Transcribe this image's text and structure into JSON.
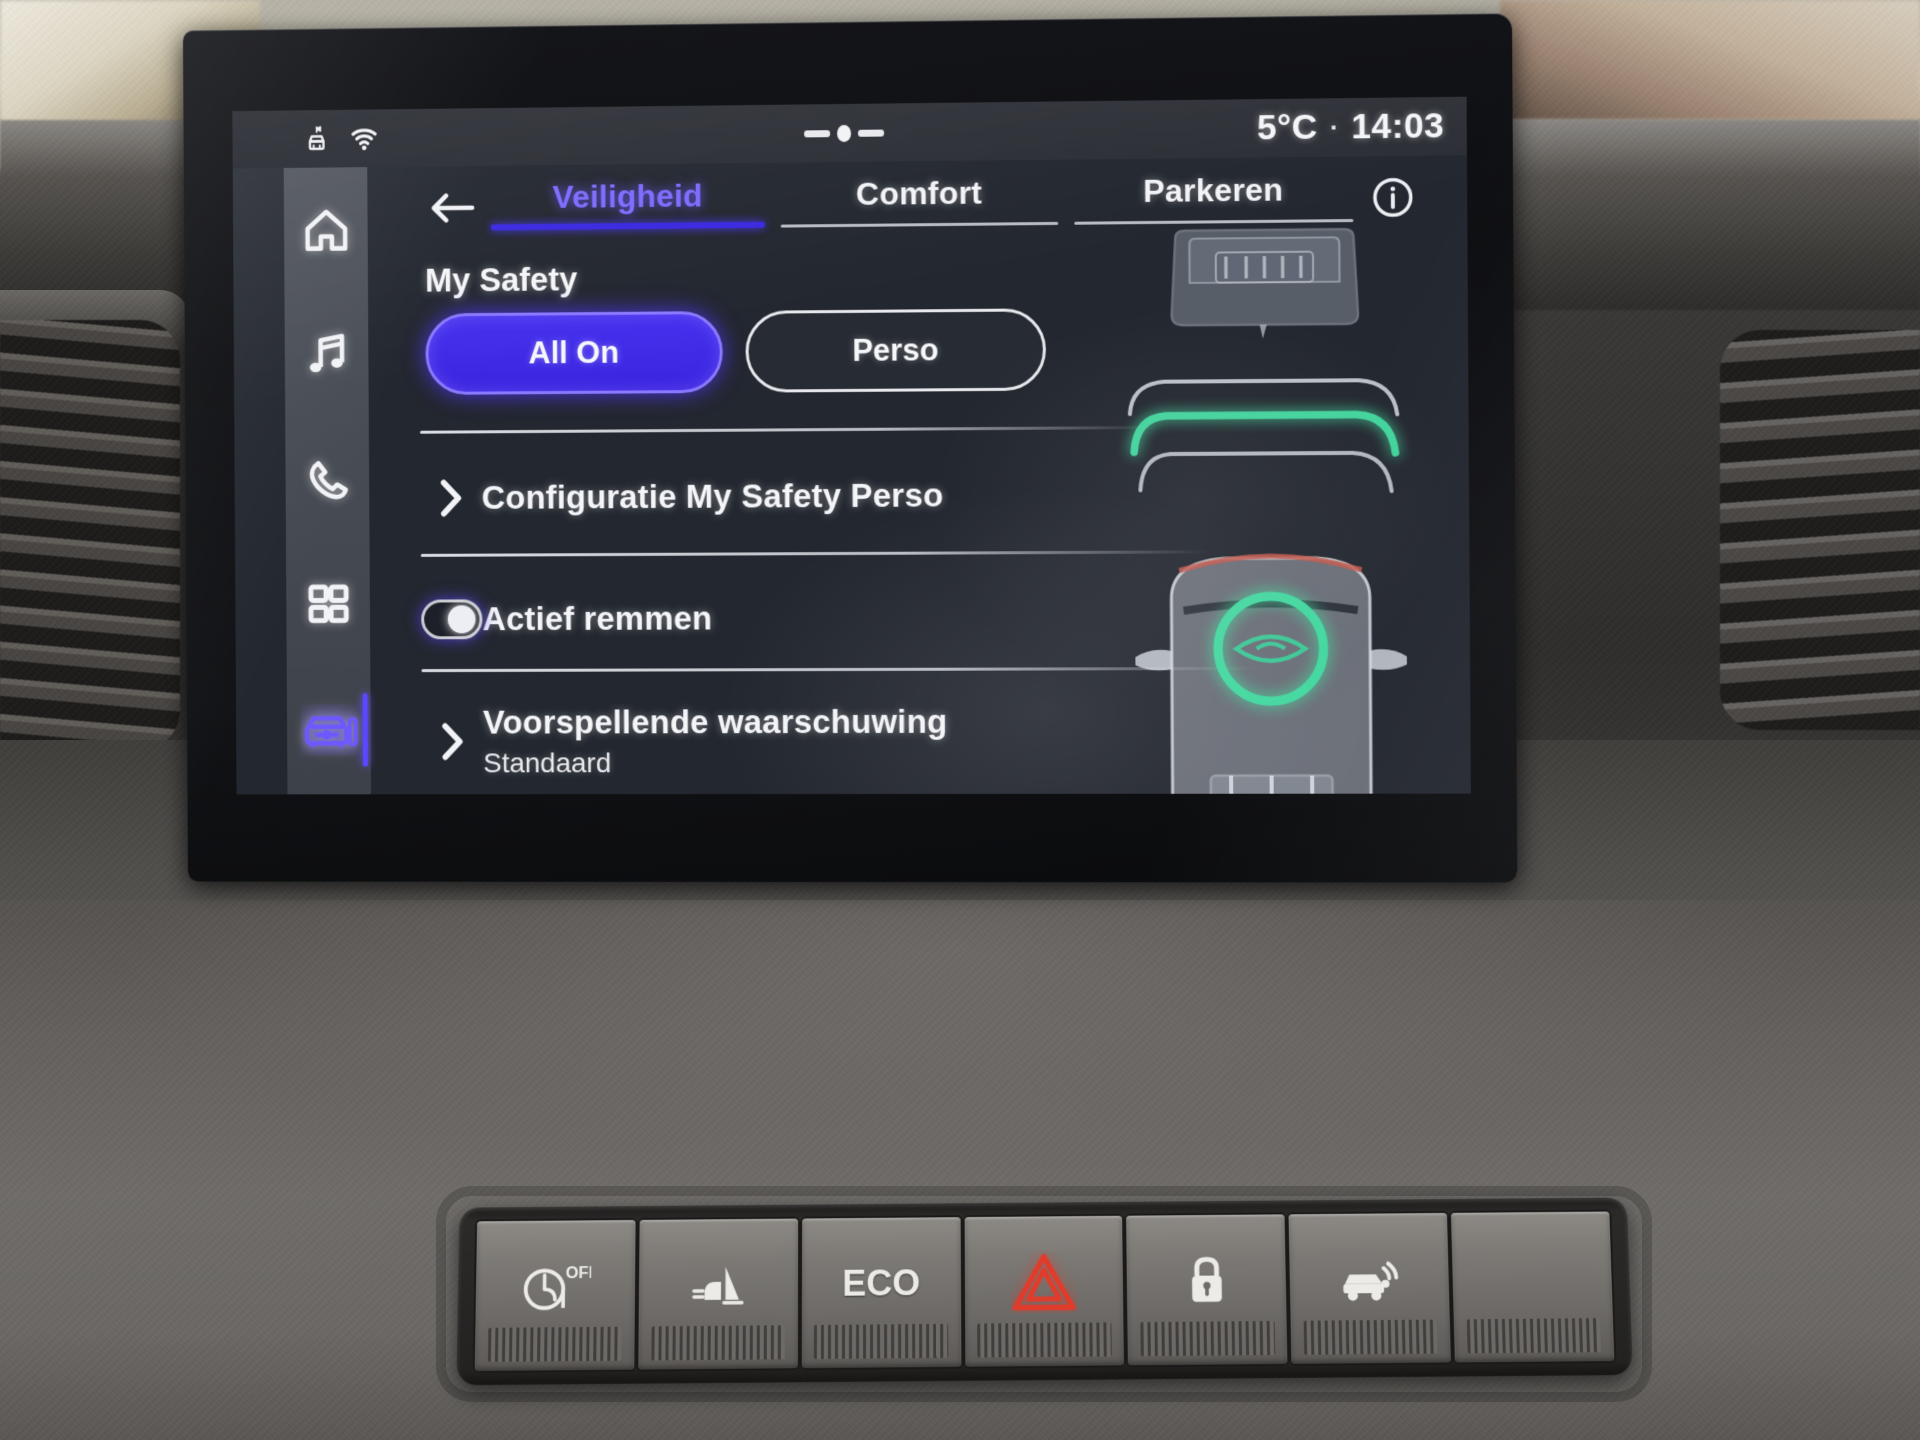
{
  "status_bar": {
    "icons": [
      "vehicle-data-icon",
      "wifi-icon"
    ],
    "page_indicator": "page-indicator-dots",
    "temperature": "5°C",
    "separator": "·",
    "clock": "14:03"
  },
  "sidebar": {
    "items": [
      {
        "name": "home",
        "icon": "home-icon",
        "active": false
      },
      {
        "name": "media",
        "icon": "music-note-icon",
        "active": false
      },
      {
        "name": "phone",
        "icon": "phone-icon",
        "active": false
      },
      {
        "name": "apps",
        "icon": "apps-grid-icon",
        "active": false
      },
      {
        "name": "vehicle",
        "icon": "car-settings-icon",
        "active": true
      }
    ]
  },
  "header": {
    "back_icon": "back-arrow-icon",
    "info_icon": "info-circle-icon",
    "tabs": [
      {
        "label": "Veiligheid",
        "active": true
      },
      {
        "label": "Comfort",
        "active": false
      },
      {
        "label": "Parkeren",
        "active": false
      }
    ]
  },
  "main": {
    "section_title": "My Safety",
    "mode_buttons": [
      {
        "label": "All On",
        "selected": true
      },
      {
        "label": "Perso",
        "selected": false
      }
    ],
    "rows": [
      {
        "type": "link",
        "chevron": "chevron-right-icon",
        "title": "Configuratie My Safety Perso",
        "subtitle": ""
      },
      {
        "type": "toggle",
        "title": "Actief remmen",
        "subtitle": "",
        "toggle_state": "on"
      },
      {
        "type": "link",
        "chevron": "chevron-right-icon",
        "title": "Voorspellende waarschuwing",
        "subtitle": "Standaard"
      }
    ],
    "illustration": {
      "name": "active-braking-illustration",
      "elements": [
        "lead-vehicle-rear",
        "radar-wave-arcs",
        "ego-vehicle-top-view",
        "sensor-eye-icon"
      ],
      "active_wave_color": "#44d8a0",
      "sensor_color": "#44d8a0"
    }
  },
  "colors": {
    "accent_purple": "#3a25e0",
    "accent_purple_text": "#7d6bff",
    "screen_bg": "#23272f",
    "status_bar_bg": "#2f3138",
    "text_primary": "#f4f5f8",
    "radar_green": "#44d8a0",
    "hazard_red": "#e03c2c"
  },
  "physical_buttons": [
    {
      "name": "stop-start-off-button",
      "icon": "auto-stop-start-off-icon",
      "label": "OFF"
    },
    {
      "name": "hill-descent-button",
      "icon": "hill-descent-control-icon",
      "label": ""
    },
    {
      "name": "eco-mode-button",
      "icon": "",
      "label": "ECO"
    },
    {
      "name": "hazard-lights-button",
      "icon": "hazard-triangle-icon",
      "label": ""
    },
    {
      "name": "central-lock-button",
      "icon": "door-lock-icon",
      "label": ""
    },
    {
      "name": "parking-sensor-button",
      "icon": "parking-assist-icon",
      "label": ""
    },
    {
      "name": "blank-button",
      "icon": "",
      "label": ""
    }
  ]
}
